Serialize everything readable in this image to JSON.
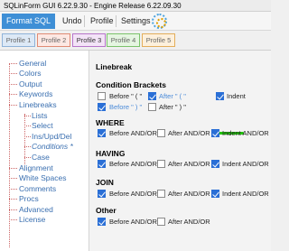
{
  "window": {
    "title": "SQLinForm GUI 6.22.9.30 - Engine Release 6.22.09.30"
  },
  "toolbar": {
    "format_label": "Format SQL",
    "undo_label": "Undo",
    "profile_label": "Profile",
    "settings_label": "Settings",
    "logo_icon": "sqlinform-logo-icon"
  },
  "profiles": [
    "Profile 1",
    "Profile 2",
    "Profile 3",
    "Profile 4",
    "Profile 5"
  ],
  "tree": {
    "items": [
      "General",
      "Colors",
      "Output",
      "Keywords",
      "Linebreaks",
      "Lists",
      "Select",
      "Ins/Upd/Del",
      "Conditions *",
      "Case",
      "Alignment",
      "White Spaces",
      "Comments",
      "Procs",
      "Advanced",
      "License"
    ]
  },
  "panel": {
    "title": "Linebreak",
    "condition_brackets": {
      "heading": "Condition Brackets",
      "options": [
        {
          "label": "Before \" ( \"",
          "checked": false
        },
        {
          "label": "After \" ( \"",
          "checked": true
        },
        {
          "label": "Indent",
          "checked": true
        },
        {
          "label": "Before \" ) \"",
          "checked": true
        },
        {
          "label": "After \" ) \"",
          "checked": false
        }
      ]
    },
    "where": {
      "heading": "WHERE",
      "before": "Before AND/OR",
      "after": "After AND/OR",
      "indent": "Indent AND/OR"
    },
    "having": {
      "heading": "HAVING",
      "before": "Before AND/OR",
      "after": "After AND/OR",
      "indent": "Indent AND/OR"
    },
    "join": {
      "heading": "JOIN",
      "before": "Before AND/OR",
      "after": "After AND/OR",
      "indent": "Indent AND/OR"
    },
    "other": {
      "heading": "Other",
      "before": "Before AND/OR",
      "after": "After AND/OR"
    }
  },
  "colors": {
    "accent": "#3e8fd6",
    "check": "#2a6fd6",
    "highlight": "#22c40e",
    "tree_link": "#3a6fb0"
  }
}
